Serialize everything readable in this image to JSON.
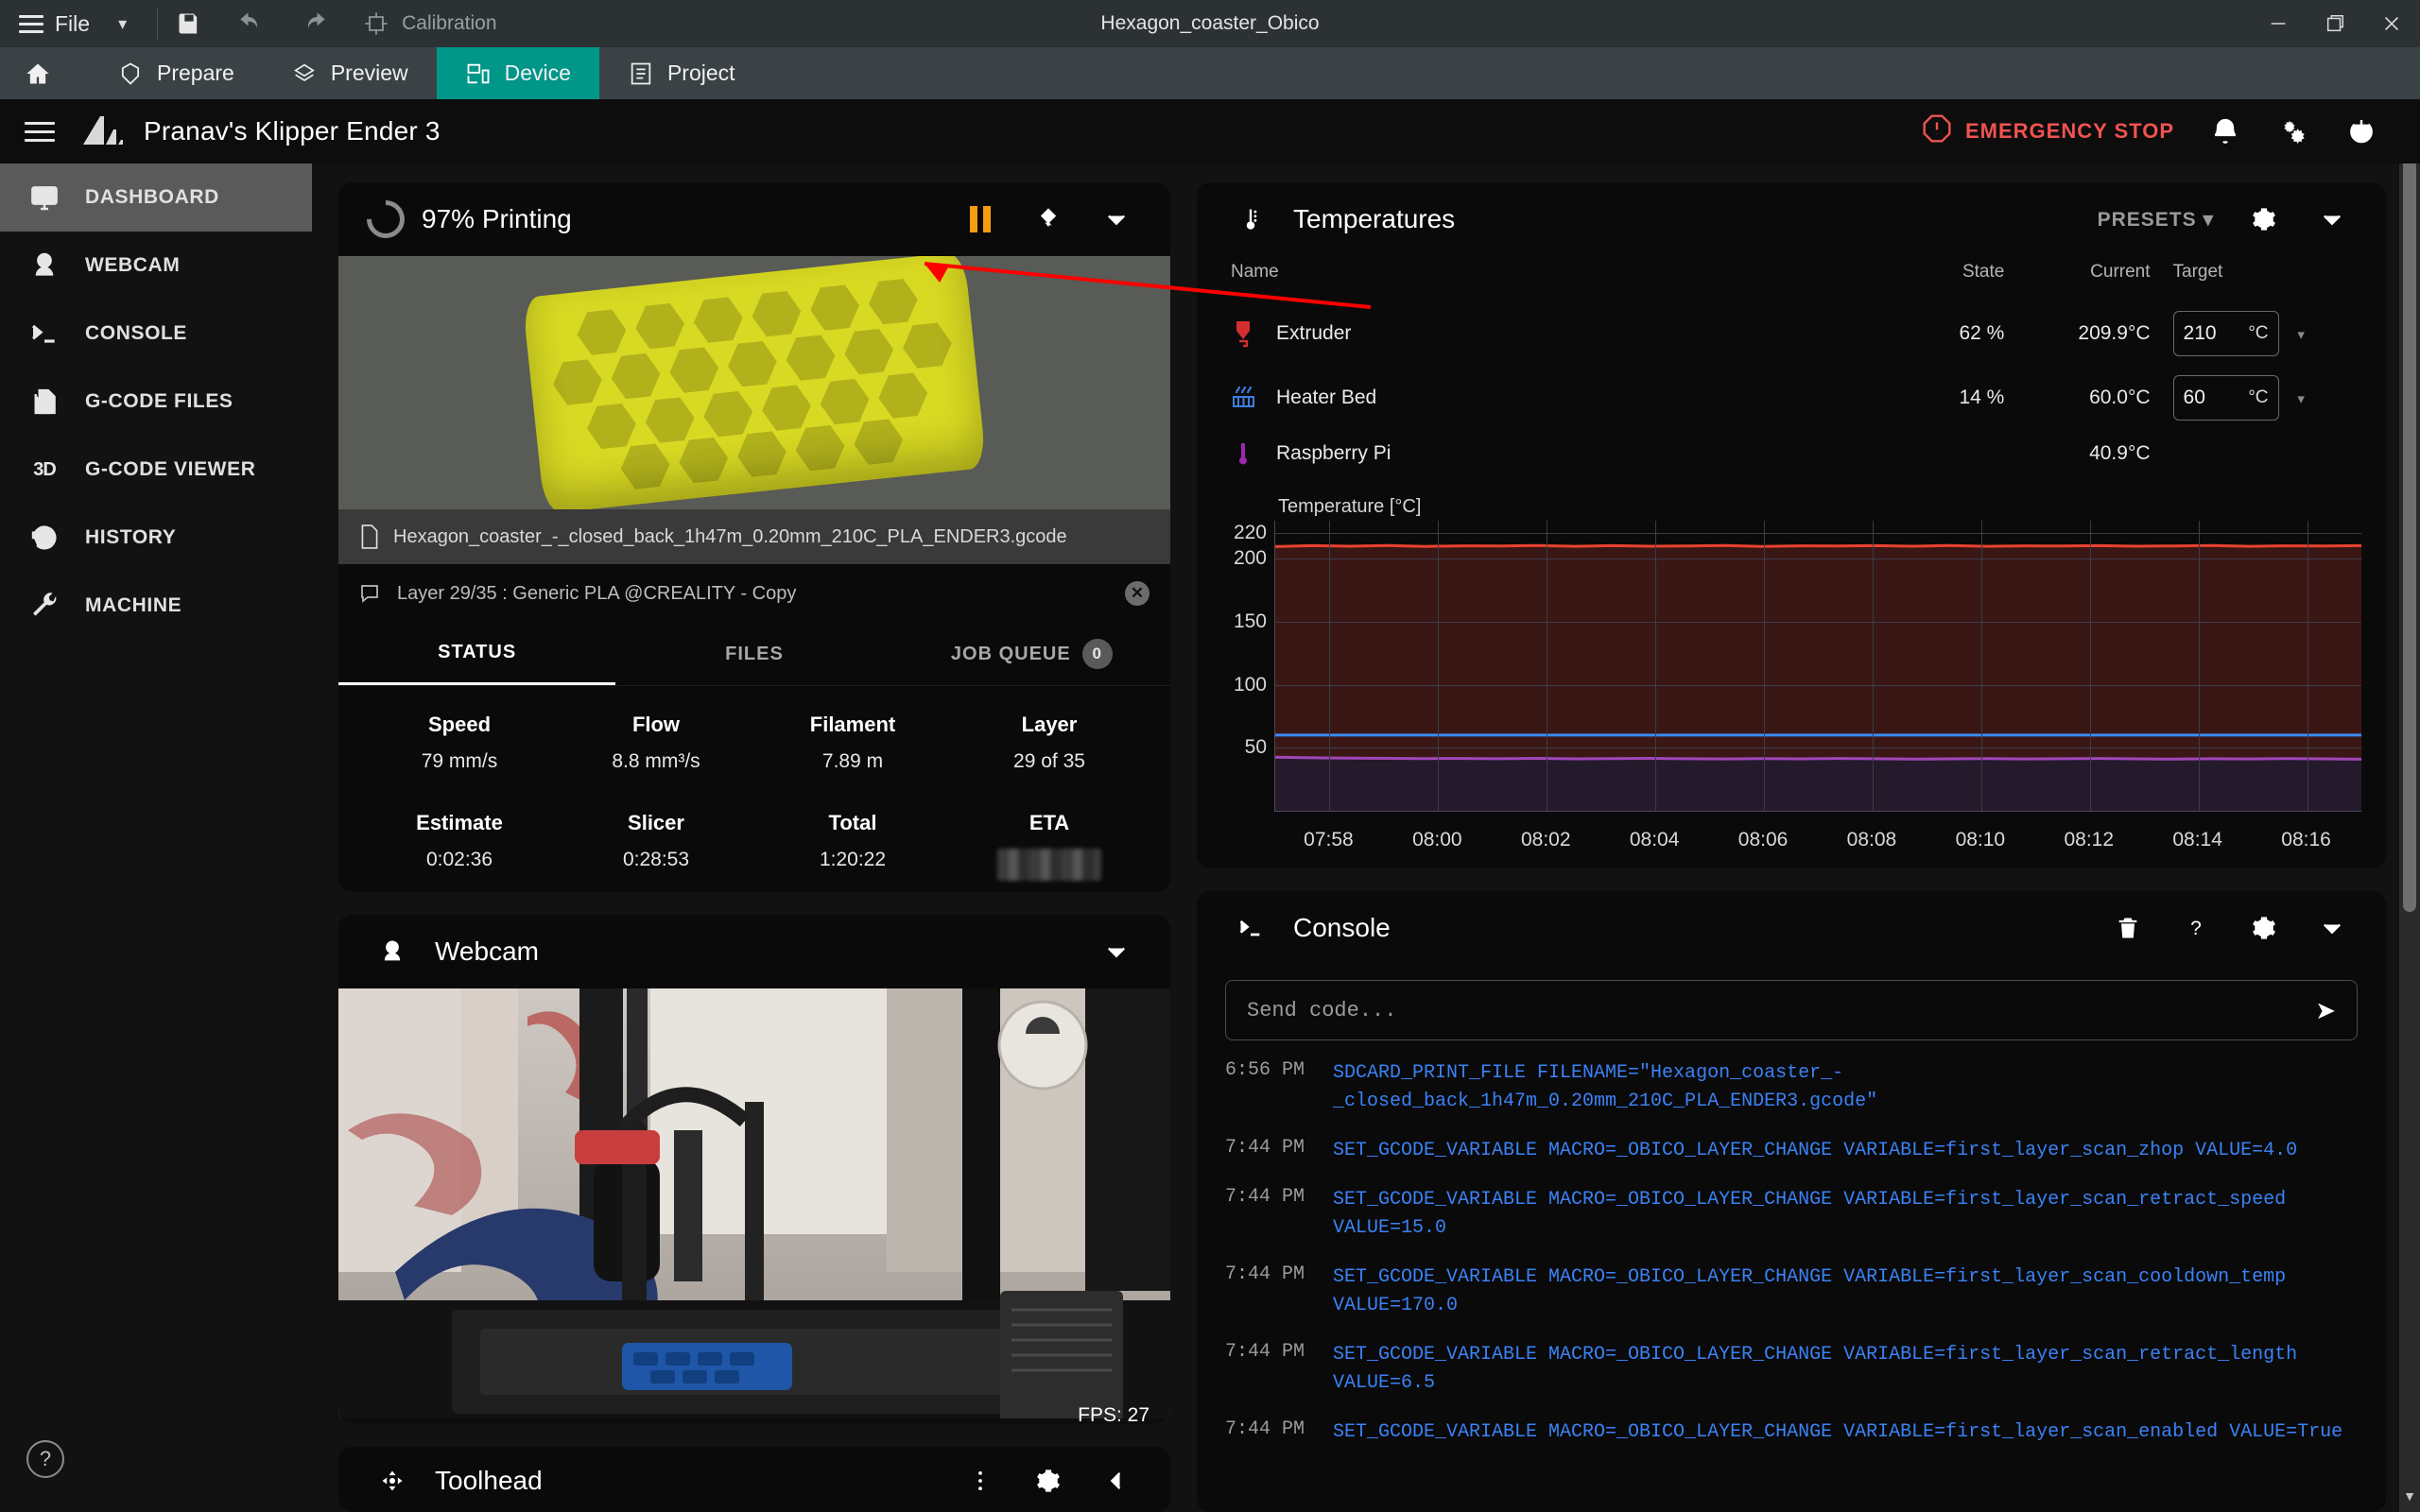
{
  "titlebar": {
    "file_label": "File",
    "calibration_label": "Calibration",
    "document_title": "Hexagon_coaster_Obico",
    "icons": {
      "save": "save-icon",
      "undo": "undo-icon",
      "redo": "redo-icon",
      "calibration": "calibration-icon"
    },
    "window_buttons": {
      "minimize": "minimize-icon",
      "maximize": "maximize-icon",
      "close": "close-icon"
    }
  },
  "slicer_tabs": [
    {
      "label": "",
      "icon": "home-icon",
      "active": false
    },
    {
      "label": "Prepare",
      "icon": "prepare-icon",
      "active": false
    },
    {
      "label": "Preview",
      "icon": "preview-icon",
      "active": false
    },
    {
      "label": "Device",
      "icon": "device-icon",
      "active": true
    },
    {
      "label": "Project",
      "icon": "project-icon",
      "active": false
    }
  ],
  "appbar": {
    "printer_name": "Pranav's Klipper Ender 3",
    "emergency_stop": "EMERGENCY STOP",
    "icons": {
      "notifications": "bell-icon",
      "settings": "gears-icon",
      "power": "power-icon"
    },
    "accent": "#009688",
    "danger": "#ef5350"
  },
  "sidebar": {
    "items": [
      {
        "label": "DASHBOARD",
        "icon": "dashboard-icon",
        "active": true
      },
      {
        "label": "WEBCAM",
        "icon": "webcam-icon",
        "active": false
      },
      {
        "label": "CONSOLE",
        "icon": "console-icon",
        "active": false
      },
      {
        "label": "G-CODE FILES",
        "icon": "file-copy-icon",
        "active": false
      },
      {
        "label": "G-CODE VIEWER",
        "icon": "3d-icon",
        "active": false
      },
      {
        "label": "HISTORY",
        "icon": "history-icon",
        "active": false
      },
      {
        "label": "MACHINE",
        "icon": "wrench-icon",
        "active": false
      }
    ],
    "help_label": "?"
  },
  "print_status": {
    "title": "97% Printing",
    "progress_percent": 97,
    "filename": "Hexagon_coaster_-_closed_back_1h47m_0.20mm_210C_PLA_ENDER3.gcode",
    "message": "Layer 29/35 : Generic PLA @CREALITY - Copy",
    "tabs": [
      {
        "label": "STATUS",
        "active": true
      },
      {
        "label": "FILES",
        "active": false
      },
      {
        "label": "JOB QUEUE",
        "active": false,
        "badge": "0"
      }
    ],
    "stats": [
      {
        "label": "Speed",
        "value": "79 mm/s"
      },
      {
        "label": "Flow",
        "value": "8.8 mm³/s"
      },
      {
        "label": "Filament",
        "value": "7.89 m"
      },
      {
        "label": "Layer",
        "value": "29 of 35"
      },
      {
        "label": "Estimate",
        "value": "0:02:36"
      },
      {
        "label": "Slicer",
        "value": "0:28:53"
      },
      {
        "label": "Total",
        "value": "1:20:22"
      },
      {
        "label": "ETA",
        "value": ""
      }
    ]
  },
  "webcam": {
    "title": "Webcam",
    "fps": "FPS: 27"
  },
  "toolhead": {
    "title": "Toolhead"
  },
  "temperatures": {
    "title": "Temperatures",
    "presets_label": "PRESETS",
    "columns": {
      "name": "Name",
      "state": "State",
      "current": "Current",
      "target": "Target"
    },
    "rows": [
      {
        "name": "Extruder",
        "icon": "extruder-icon",
        "color": "#d32f2f",
        "state": "62 %",
        "current": "209.9°C",
        "target": "210",
        "unit": "°C"
      },
      {
        "name": "Heater Bed",
        "icon": "heater-bed-icon",
        "color": "#3d7fe0",
        "state": "14 %",
        "current": "60.0°C",
        "target": "60",
        "unit": "°C"
      },
      {
        "name": "Raspberry Pi",
        "icon": "thermometer-icon",
        "color": "#9c27b0",
        "state": "",
        "current": "40.9°C",
        "target": "",
        "unit": ""
      }
    ]
  },
  "chart_data": {
    "type": "line",
    "title": "Temperature [°C]",
    "xlabel": "",
    "ylabel": "Temperature [°C]",
    "ylim": [
      0,
      230
    ],
    "yticks": [
      50,
      100,
      150,
      200,
      220
    ],
    "xticks": [
      "07:58",
      "08:00",
      "08:02",
      "08:04",
      "08:06",
      "08:08",
      "08:10",
      "08:12",
      "08:14",
      "08:16"
    ],
    "grid": true,
    "legend": "none",
    "series": [
      {
        "name": "Extruder",
        "color": "#e8422f",
        "fill": "#3a1714",
        "values": [
          209.5,
          210.2,
          209.8,
          210.4,
          209.6,
          210.1,
          209.9,
          210.3,
          209.7,
          210.2,
          209.8,
          210.0,
          210.4,
          209.6,
          210.1,
          209.9,
          210.2,
          209.8,
          210.3,
          209.7,
          210.1,
          209.9,
          210.2,
          209.8,
          210.0,
          210.3,
          209.7,
          210.1,
          209.9,
          210.2
        ]
      },
      {
        "name": "Heater Bed Target",
        "color": "#3d8bfd",
        "fill": "none",
        "values": [
          60,
          60,
          60,
          60,
          60,
          60,
          60,
          60,
          60,
          60,
          60,
          60,
          60,
          60,
          60,
          60,
          60,
          60,
          60,
          60,
          60,
          60,
          60,
          60,
          60,
          60,
          60,
          60,
          60,
          60
        ]
      },
      {
        "name": "Raspberry Pi",
        "color": "#a047b8",
        "fill": "#241a2c",
        "values": [
          42.5,
          42.0,
          41.8,
          41.6,
          41.4,
          41.5,
          41.3,
          41.6,
          41.2,
          41.4,
          41.6,
          41.3,
          41.1,
          41.4,
          41.2,
          41.5,
          41.3,
          41.0,
          41.2,
          41.4,
          41.1,
          41.3,
          41.5,
          41.2,
          41.0,
          41.3,
          41.1,
          41.4,
          41.2,
          40.9
        ]
      }
    ]
  },
  "console": {
    "title": "Console",
    "icons": {
      "clear": "trash-icon",
      "help": "question-icon",
      "settings": "gear-icon",
      "collapse": "chevron-down-icon"
    },
    "input_placeholder": "Send code...",
    "send_icon": "send-icon",
    "lines": [
      {
        "time": "6:56 PM",
        "message": "SDCARD_PRINT_FILE FILENAME=\"Hexagon_coaster_-_closed_back_1h47m_0.20mm_210C_PLA_ENDER3.gcode\""
      },
      {
        "time": "7:44 PM",
        "message": "SET_GCODE_VARIABLE MACRO=_OBICO_LAYER_CHANGE VARIABLE=first_layer_scan_zhop VALUE=4.0"
      },
      {
        "time": "7:44 PM",
        "message": "SET_GCODE_VARIABLE MACRO=_OBICO_LAYER_CHANGE VARIABLE=first_layer_scan_retract_speed VALUE=15.0"
      },
      {
        "time": "7:44 PM",
        "message": "SET_GCODE_VARIABLE MACRO=_OBICO_LAYER_CHANGE VARIABLE=first_layer_scan_cooldown_temp VALUE=170.0"
      },
      {
        "time": "7:44 PM",
        "message": "SET_GCODE_VARIABLE MACRO=_OBICO_LAYER_CHANGE VARIABLE=first_layer_scan_retract_length VALUE=6.5"
      },
      {
        "time": "7:44 PM",
        "message": "SET_GCODE_VARIABLE MACRO=_OBICO_LAYER_CHANGE VARIABLE=first_layer_scan_enabled VALUE=True"
      }
    ]
  },
  "annotation": {
    "arrow_color": "#ff0000"
  }
}
